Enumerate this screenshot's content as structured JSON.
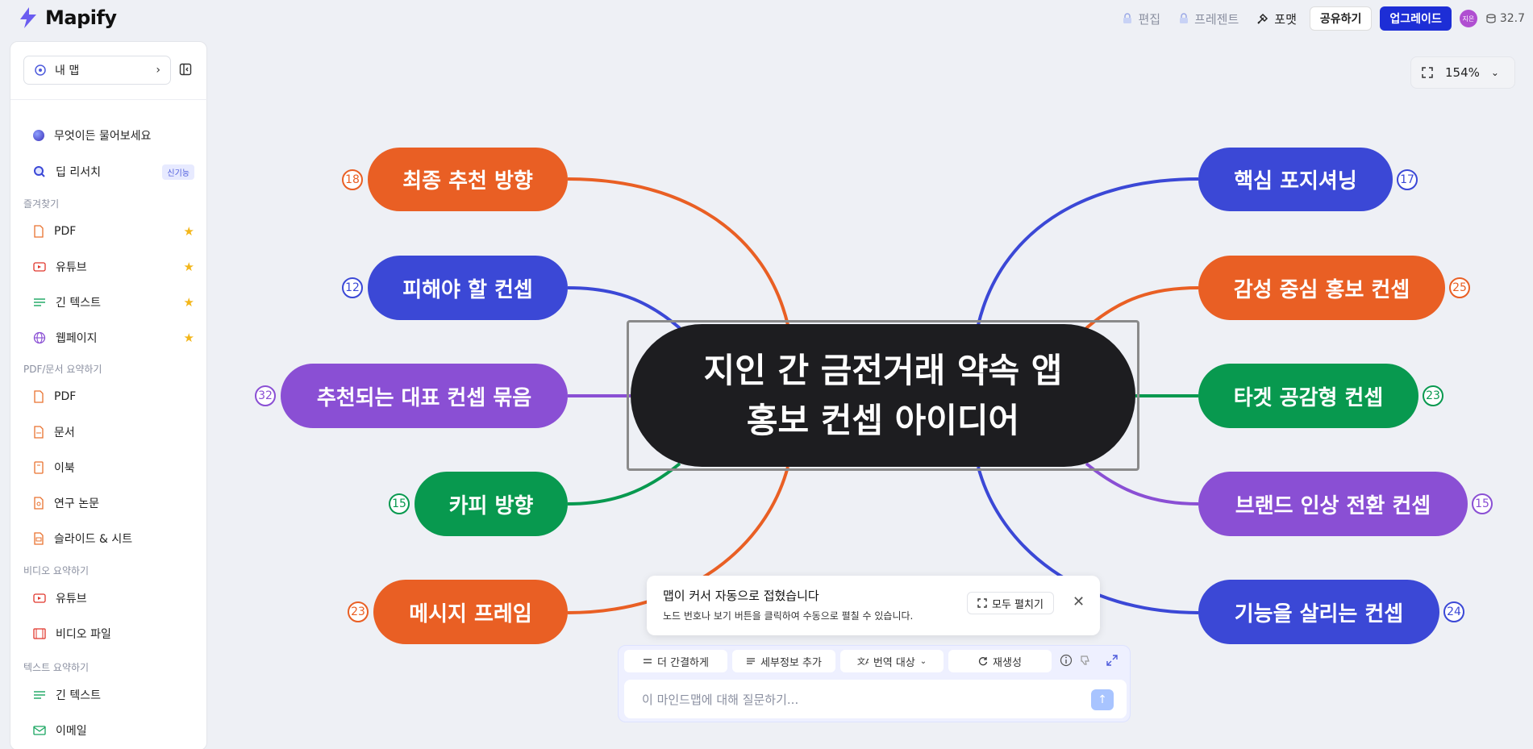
{
  "app": {
    "name": "Mapify"
  },
  "topbar": {
    "edit": "편집",
    "present": "프레젠트",
    "format": "포맷",
    "share": "공유하기",
    "upgrade": "업그레이드",
    "avatar_text": "지은",
    "credits": "32.7"
  },
  "sidebar": {
    "my_map": "내 맵",
    "ask_anything": "무엇이든 물어보세요",
    "deep_research": "딥 리서치",
    "new_badge": "신기능",
    "favorites_header": "즐겨찾기",
    "favorites": [
      "PDF",
      "유튜브",
      "긴 텍스트",
      "웹페이지"
    ],
    "pdf_header": "PDF/문서 요약하기",
    "pdf_items": [
      "PDF",
      "문서",
      "이북",
      "연구 논문",
      "슬라이드 & 시트"
    ],
    "video_header": "비디오 요약하기",
    "video_items": [
      "유튜브",
      "비디오 파일"
    ],
    "text_header": "텍스트 요약하기",
    "text_items": [
      "긴 텍스트",
      "이메일"
    ]
  },
  "zoom": {
    "level": "154%"
  },
  "mindmap": {
    "center_line1": "지인 간 금전거래 약속 앱",
    "center_line2": "홍보 컨셉 아이디어",
    "left": [
      {
        "label": "최종 추천 방향",
        "count": "18",
        "color": "#e95f24"
      },
      {
        "label": "피해야 할 컨셉",
        "count": "12",
        "color": "#3b48d6"
      },
      {
        "label": "추천되는 대표 컨셉 묶음",
        "count": "32",
        "color": "#8a4fd4"
      },
      {
        "label": "카피 방향",
        "count": "15",
        "color": "#08994f"
      },
      {
        "label": "메시지 프레임",
        "count": "23",
        "color": "#e95f24"
      }
    ],
    "right": [
      {
        "label": "핵심 포지셔닝",
        "count": "17",
        "color": "#3b48d6"
      },
      {
        "label": "감성 중심 홍보 컨셉",
        "count": "25",
        "color": "#e95f24"
      },
      {
        "label": "타겟 공감형 컨셉",
        "count": "23",
        "color": "#08994f"
      },
      {
        "label": "브랜드 인상 전환 컨셉",
        "count": "15",
        "color": "#8a4fd4"
      },
      {
        "label": "기능을 살리는 컨셉",
        "count": "24",
        "color": "#3b48d6"
      }
    ]
  },
  "toast": {
    "title": "맵이 커서 자동으로 접혔습니다",
    "desc": "노드 번호나 보기 버튼을 클릭하여 수동으로 펼칠 수 있습니다.",
    "expand_all": "모두 펼치기"
  },
  "chat": {
    "concise": "더 간결하게",
    "details": "세부정보 추가",
    "translate": "번역 대상",
    "regenerate": "재생성",
    "placeholder": "이 마인드맵에 대해 질문하기..."
  }
}
